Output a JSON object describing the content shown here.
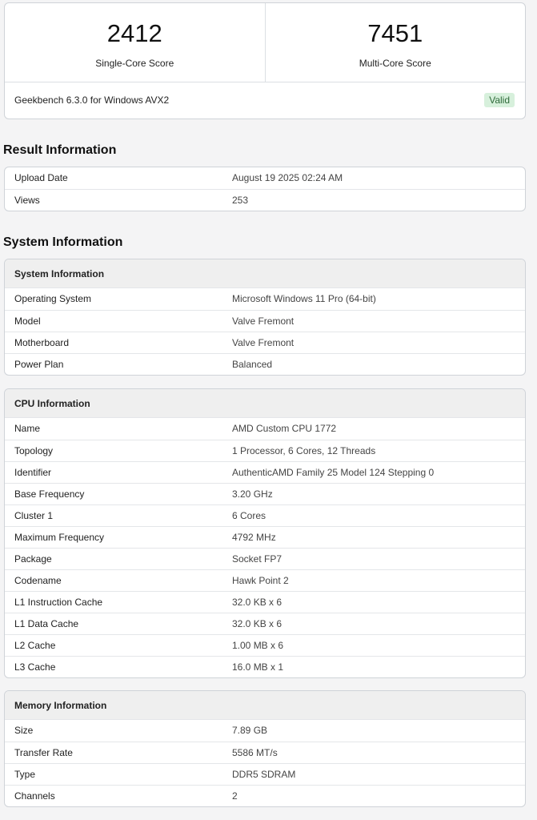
{
  "scores": {
    "single_value": "2412",
    "single_label": "Single-Core Score",
    "multi_value": "7451",
    "multi_label": "Multi-Core Score",
    "version": "Geekbench 6.3.0 for Windows AVX2",
    "status": "Valid"
  },
  "result": {
    "title": "Result Information",
    "rows": [
      {
        "label": "Upload Date",
        "value": "August 19 2025 02:24 AM"
      },
      {
        "label": "Views",
        "value": "253"
      }
    ]
  },
  "system": {
    "title": "System Information",
    "sysinfo": {
      "header": "System Information",
      "rows": [
        {
          "label": "Operating System",
          "value": "Microsoft Windows 11 Pro (64-bit)"
        },
        {
          "label": "Model",
          "value": "Valve Fremont"
        },
        {
          "label": "Motherboard",
          "value": "Valve Fremont"
        },
        {
          "label": "Power Plan",
          "value": "Balanced"
        }
      ]
    },
    "cpu": {
      "header": "CPU Information",
      "rows": [
        {
          "label": "Name",
          "value": "AMD Custom CPU 1772"
        },
        {
          "label": "Topology",
          "value": "1 Processor, 6 Cores, 12 Threads"
        },
        {
          "label": "Identifier",
          "value": "AuthenticAMD Family 25 Model 124 Stepping 0"
        },
        {
          "label": "Base Frequency",
          "value": "3.20 GHz"
        },
        {
          "label": "Cluster 1",
          "value": "6 Cores"
        },
        {
          "label": "Maximum Frequency",
          "value": "4792 MHz"
        },
        {
          "label": "Package",
          "value": "Socket FP7"
        },
        {
          "label": "Codename",
          "value": "Hawk Point 2"
        },
        {
          "label": "L1 Instruction Cache",
          "value": "32.0 KB x 6"
        },
        {
          "label": "L1 Data Cache",
          "value": "32.0 KB x 6"
        },
        {
          "label": "L2 Cache",
          "value": "1.00 MB x 6"
        },
        {
          "label": "L3 Cache",
          "value": "16.0 MB x 1"
        }
      ]
    },
    "memory": {
      "header": "Memory Information",
      "rows": [
        {
          "label": "Size",
          "value": "7.89 GB"
        },
        {
          "label": "Transfer Rate",
          "value": "5586 MT/s"
        },
        {
          "label": "Type",
          "value": "DDR5 SDRAM"
        },
        {
          "label": "Channels",
          "value": "2"
        }
      ]
    }
  }
}
